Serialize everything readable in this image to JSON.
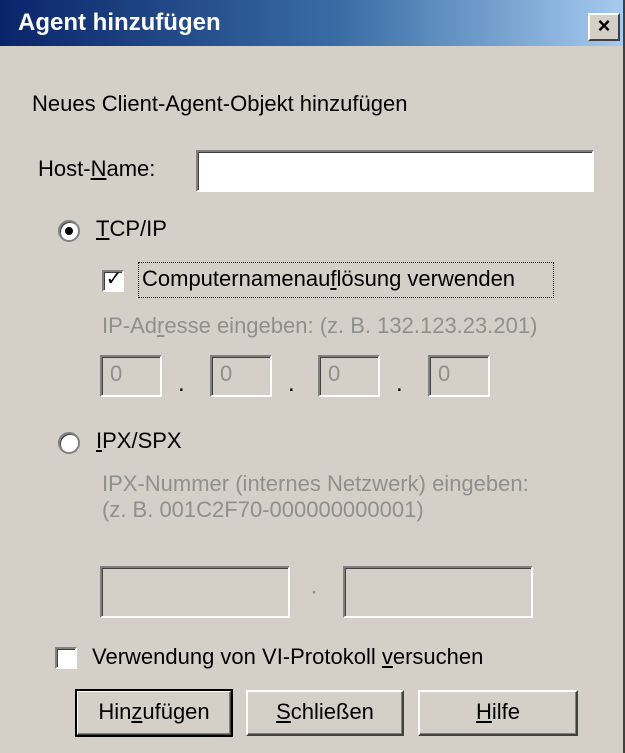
{
  "window": {
    "title": "Agent hinzufügen",
    "close_glyph": "×"
  },
  "dialog": {
    "heading": "Neues Client-Agent-Objekt hinzufügen",
    "host_name": {
      "label_pre": "Host-",
      "label_u": "N",
      "label_post": "ame:",
      "value": ""
    },
    "tcpip": {
      "selected": true,
      "label_u": "T",
      "label_post": "CP/IP",
      "resolve": {
        "checked": true,
        "label_pre": "Computernamenau",
        "label_u": "f",
        "label_post": "lösung verwenden"
      },
      "ip_hint": {
        "pre": "IP-Ad",
        "u": "r",
        "post": "esse eingeben: (z. B. 132.123.23.201)"
      },
      "octets": [
        "0",
        "0",
        "0",
        "0"
      ],
      "separator": "."
    },
    "ipxspx": {
      "selected": false,
      "label_u": "I",
      "label_post": "PX/SPX",
      "hint_line1": "IPX-Nummer (internes Netzwerk) eingeben:",
      "hint_line2": "(z. B. 001C2F70-000000000001)",
      "fields": [
        "",
        ""
      ],
      "separator": "·"
    },
    "vi_protocol": {
      "checked": false,
      "label_pre": "Verwendung von VI-Protokoll ",
      "label_u": "v",
      "label_post": "ersuchen"
    }
  },
  "buttons": {
    "add": {
      "pre": "Hin",
      "u": "z",
      "post": "ufügen"
    },
    "close": {
      "pre": "",
      "u": "S",
      "post": "chließen"
    },
    "help": {
      "pre": "",
      "u": "H",
      "post": "ilfe"
    }
  },
  "icons": {
    "radio_selected": "radio-selected-icon",
    "checkbox_checked": "checkmark-icon"
  },
  "colors": {
    "face": "#d4d0c8",
    "title_start": "#0a246a",
    "title_end": "#a6caf0",
    "disabled_text": "#8f8f8f"
  }
}
